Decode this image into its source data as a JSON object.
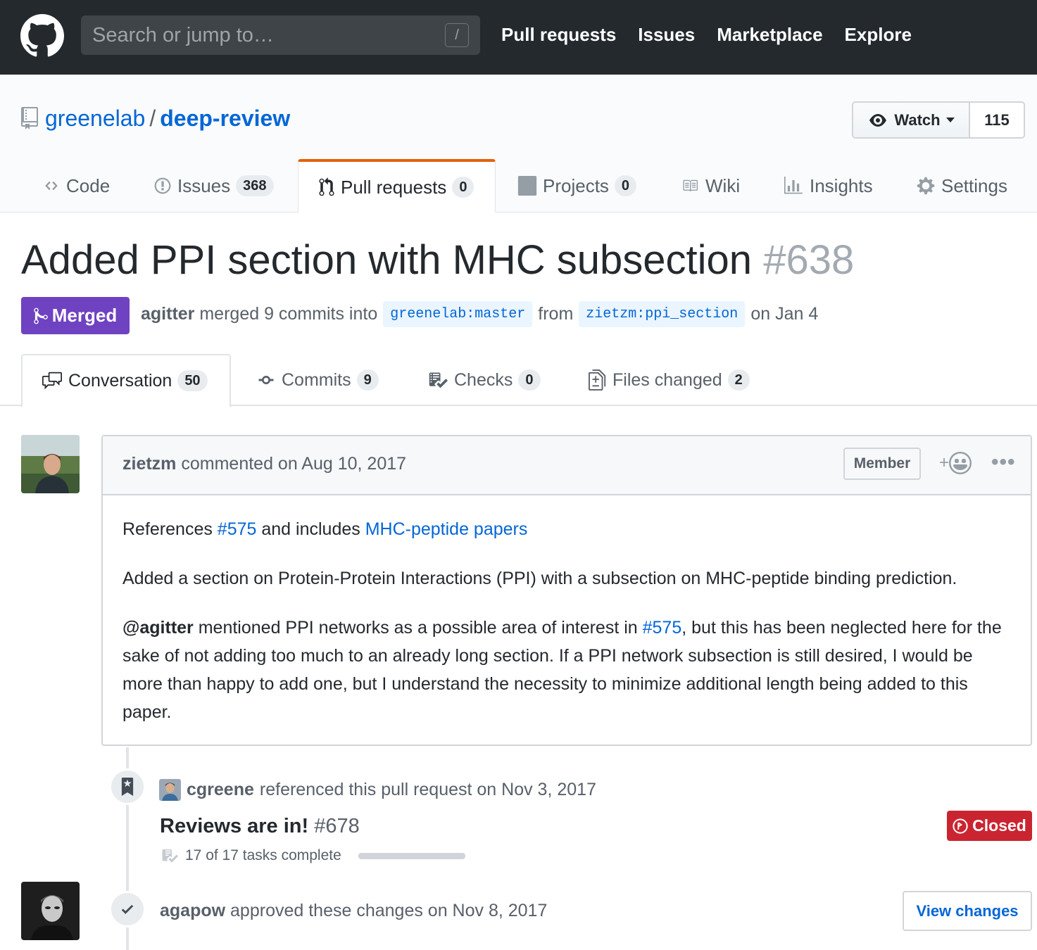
{
  "header": {
    "search_placeholder": "Search or jump to…",
    "search_key": "/",
    "nav": [
      "Pull requests",
      "Issues",
      "Marketplace",
      "Explore"
    ]
  },
  "repo": {
    "owner": "greenelab",
    "separator": "/",
    "name": "deep-review",
    "watch_label": "Watch",
    "watch_count": "115"
  },
  "repo_tabs": {
    "code": {
      "label": "Code"
    },
    "issues": {
      "label": "Issues",
      "count": "368"
    },
    "pulls": {
      "label": "Pull requests",
      "count": "0"
    },
    "projects": {
      "label": "Projects",
      "count": "0"
    },
    "wiki": {
      "label": "Wiki"
    },
    "insights": {
      "label": "Insights"
    },
    "settings": {
      "label": "Settings"
    }
  },
  "pr": {
    "title": "Added PPI section with MHC subsection",
    "number": "#638",
    "state": "Merged",
    "author": "agitter",
    "merged_text": "merged 9 commits into",
    "base_branch": "greenelab:master",
    "from_text": "from",
    "head_branch": "zietzm:ppi_section",
    "date_text": "on Jan 4"
  },
  "pr_tabs": {
    "conversation": {
      "label": "Conversation",
      "count": "50"
    },
    "commits": {
      "label": "Commits",
      "count": "9"
    },
    "checks": {
      "label": "Checks",
      "count": "0"
    },
    "files": {
      "label": "Files changed",
      "count": "2"
    }
  },
  "comment": {
    "author": "zietzm",
    "action": "commented on Aug 10, 2017",
    "role": "Member",
    "react": "+",
    "more": "•••",
    "p1_prefix": "References ",
    "p1_link1": "#575",
    "p1_mid": " and includes ",
    "p1_link2": "MHC-peptide papers",
    "p2": "Added a section on Protein-Protein Interactions (PPI) with a subsection on MHC-peptide binding prediction.",
    "p3_mention": "@agitter",
    "p3_a": " mentioned PPI networks as a possible area of interest in ",
    "p3_link": "#575",
    "p3_b": ", but this has been neglected here for the sake of not adding too much to an already long section. If a PPI network subsection is still desired, I would be more than happy to add one, but I understand the necessity to minimize additional length being added to this paper."
  },
  "timeline": {
    "reference": {
      "user": "cgreene",
      "action": "referenced this pull request on Nov 3, 2017",
      "title": "Reviews are in!",
      "number": "#678",
      "state": "Closed",
      "tasks": "17 of 17 tasks complete",
      "progress": 1.0
    },
    "review": {
      "user": "agapow",
      "action": "approved these changes on Nov 8, 2017",
      "button": "View changes"
    }
  },
  "colors": {
    "header_bg": "#24292e",
    "link": "#0366d6",
    "merged": "#6f42c1",
    "closed": "#cb2431",
    "selected_tab_accent": "#e36209"
  }
}
